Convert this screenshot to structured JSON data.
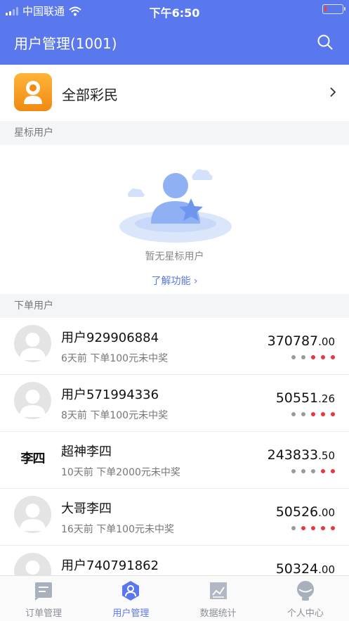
{
  "status": {
    "carrier": "中国联通",
    "time": "下午6:50",
    "battery_level": 0.12
  },
  "header": {
    "title": "用户管理(1001)"
  },
  "all_users": {
    "label": "全部彩民"
  },
  "starred": {
    "section_title": "星标用户",
    "empty_text": "暂无星标用户",
    "learn_link": "了解功能 ›"
  },
  "orders": {
    "section_title": "下单用户",
    "users": [
      {
        "name": "用户929906884",
        "desc": "6天前  下单100元未中奖",
        "amount_int": "370787",
        "amount_dec": ".00",
        "avatar": "default",
        "dots": [
          "gray",
          "gray",
          "red",
          "red",
          "red"
        ]
      },
      {
        "name": "用户571994336",
        "desc": "8天前  下单100元未中奖",
        "amount_int": "50551",
        "amount_dec": ".26",
        "avatar": "default",
        "dots": [
          "gray",
          "gray",
          "red",
          "red",
          "red"
        ]
      },
      {
        "name": "超神李四",
        "desc": "10天前  下单2000元未中奖",
        "amount_int": "243833",
        "amount_dec": ".50",
        "avatar": "text",
        "avatar_text": "李四",
        "dots": [
          "gray",
          "gray",
          "gray",
          "red",
          "red"
        ]
      },
      {
        "name": "大哥李四",
        "desc": "16天前  下单100元未中奖",
        "amount_int": "50526",
        "amount_dec": ".00",
        "avatar": "default",
        "dots": [
          "gray",
          "red",
          "red",
          "red",
          "red"
        ]
      },
      {
        "name": "用户740791862",
        "desc": "",
        "amount_int": "50324",
        "amount_dec": ".00",
        "avatar": "default",
        "dots": []
      }
    ]
  },
  "tabs": [
    {
      "label": "订单管理",
      "icon": "order-icon",
      "active": false
    },
    {
      "label": "用户管理",
      "icon": "user-manage-icon",
      "active": true
    },
    {
      "label": "数据统计",
      "icon": "chart-icon",
      "active": false
    },
    {
      "label": "个人中心",
      "icon": "profile-icon",
      "active": false
    }
  ],
  "colors": {
    "brand": "#5a78ee",
    "dot_red": "#e8383d",
    "dot_gray": "#9a9a9a"
  }
}
